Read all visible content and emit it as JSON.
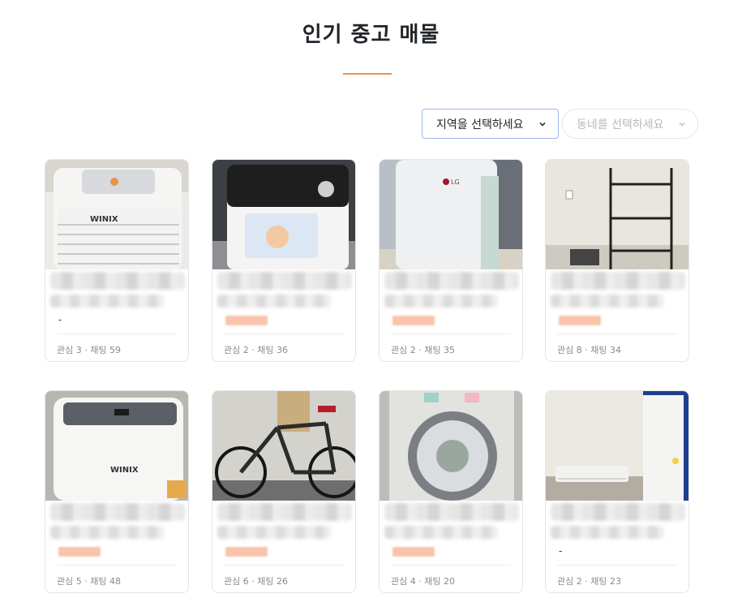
{
  "page": {
    "title": "인기 중고 매물"
  },
  "filters": {
    "region_select": {
      "value": "지역을 선택하세요"
    },
    "town_select": {
      "value": "동네를 선택하세요"
    }
  },
  "products": [
    {
      "image": "dehumidifier-winix-icon",
      "price_shown": false,
      "stats": "관심 3 · 채팅 59"
    },
    {
      "image": "air-purifier-icon",
      "price_shown": true,
      "stats": "관심 2 · 채팅 36"
    },
    {
      "image": "dehumidifier-lg-icon",
      "price_shown": true,
      "stats": "관심 2 · 채팅 35"
    },
    {
      "image": "metal-shelf-icon",
      "price_shown": true,
      "stats": "관심 8 · 채팅 34"
    },
    {
      "image": "portable-ac-winix-icon",
      "price_shown": true,
      "stats": "관심 5 · 채팅 48"
    },
    {
      "image": "bicycle-icon",
      "price_shown": true,
      "stats": "관심 6 · 채팅 26"
    },
    {
      "image": "washing-machine-icon",
      "price_shown": true,
      "stats": "관심 4 · 채팅 20"
    },
    {
      "image": "air-conditioner-icon",
      "price_shown": false,
      "stats": "관심 2 · 채팅 23"
    }
  ],
  "colors": {
    "accent": "#e6944a",
    "price_blur": "#f9c4aa",
    "select_focus": "#9bb7e8"
  }
}
